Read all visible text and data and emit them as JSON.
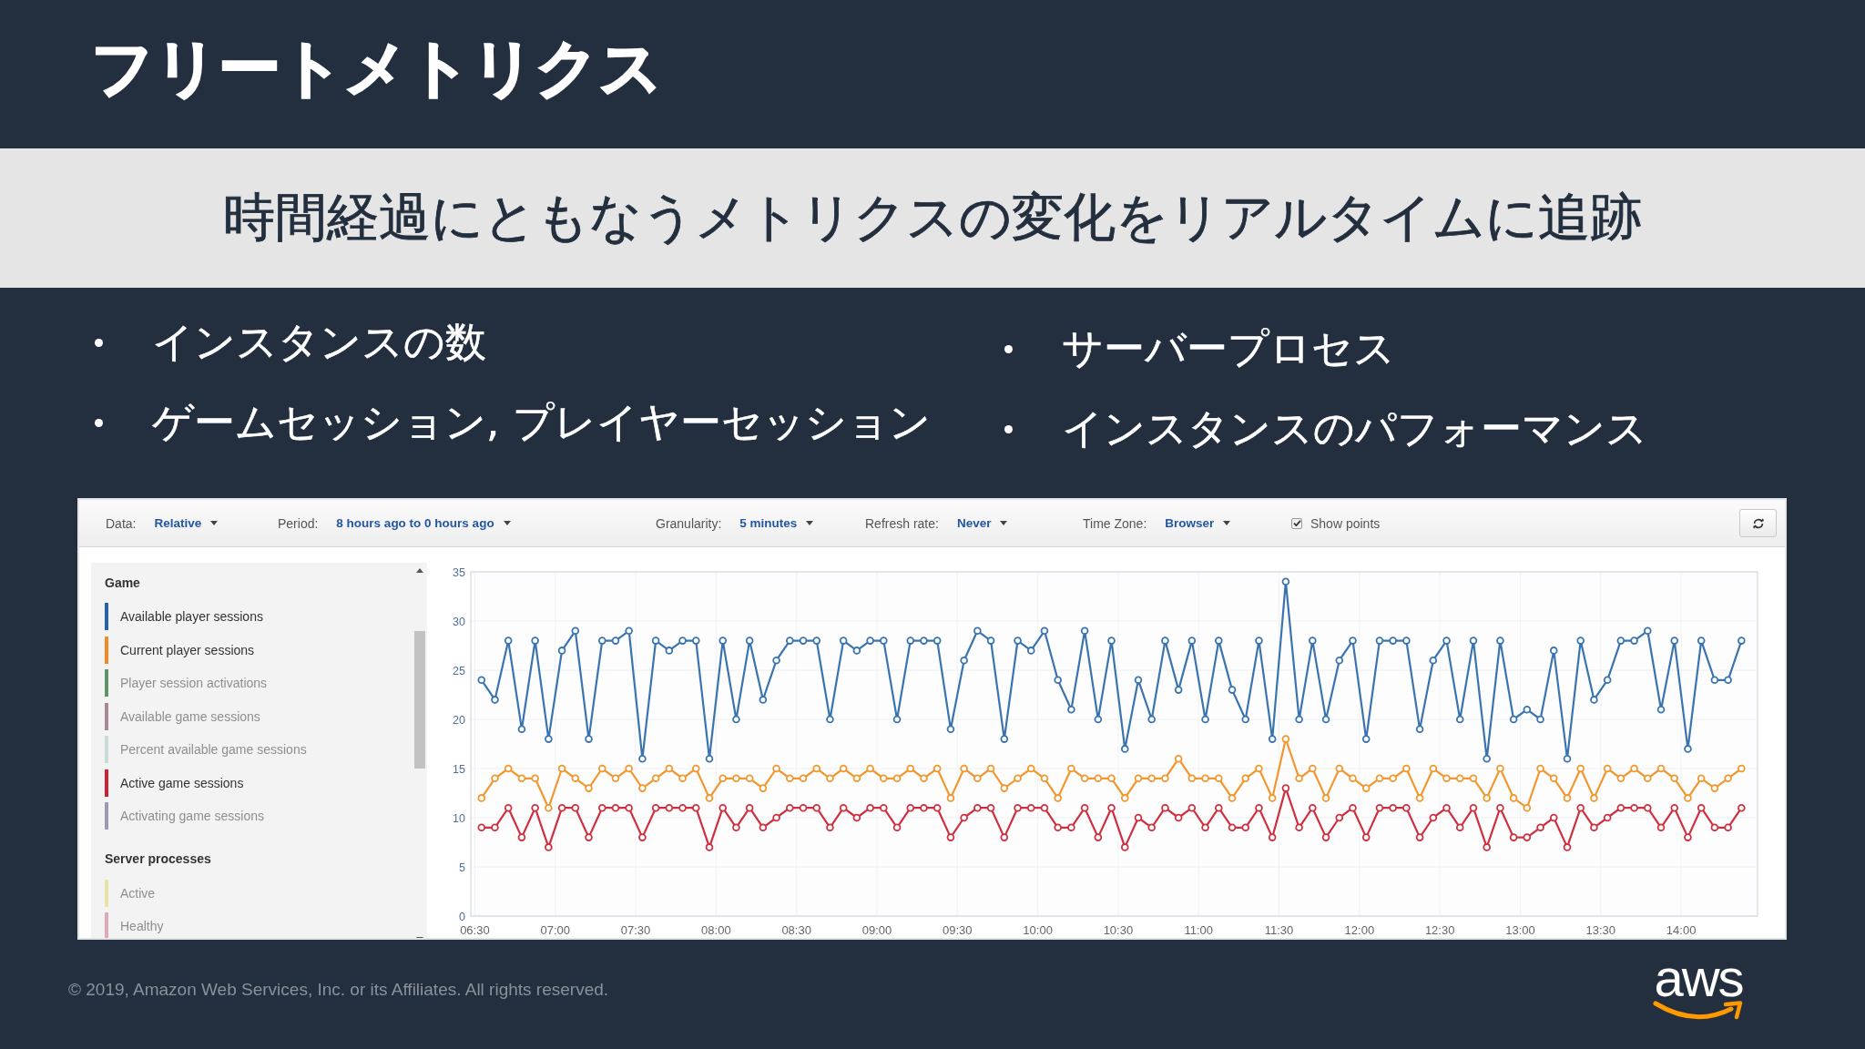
{
  "header": {
    "title": "フリートメトリクス"
  },
  "subtitle": {
    "text": "時間経過にともなうメトリクスの変化をリアルタイムに追跡"
  },
  "bullet_columns": [
    {
      "items": [
        "インスタンスの数",
        "ゲームセッション, プレイヤーセッション"
      ]
    },
    {
      "items": [
        "サーバープロセス",
        "インスタンスのパフォーマンス"
      ]
    }
  ],
  "metrics_console": {
    "toolbar": {
      "filters": [
        {
          "label": "Data:",
          "value": "Relative"
        },
        {
          "label": "Period:",
          "value": "8 hours ago to 0 hours ago"
        },
        {
          "label": "Granularity:",
          "value": "5 minutes"
        },
        {
          "label": "Refresh rate:",
          "value": "Never"
        },
        {
          "label": "Time Zone:",
          "value": "Browser"
        }
      ],
      "show_points": {
        "label": "Show points",
        "checked": true
      }
    },
    "legend": {
      "groups": [
        {
          "title": "Game",
          "items": [
            {
              "label": "Available player sessions",
              "color": "#2563ae",
              "visible": true
            },
            {
              "label": "Current player sessions",
              "color": "#f08a24",
              "visible": true
            },
            {
              "label": "Player session activations",
              "color": "#5e9468",
              "visible": false
            },
            {
              "label": "Available game sessions",
              "color": "#a78896",
              "visible": false
            },
            {
              "label": "Percent available game sessions",
              "color": "#c9dad9",
              "visible": false
            },
            {
              "label": "Active game sessions",
              "color": "#cc2233",
              "visible": true
            },
            {
              "label": "Activating game sessions",
              "color": "#9c9ab3",
              "visible": false
            }
          ]
        },
        {
          "title": "Server processes",
          "items": [
            {
              "label": "Active",
              "color": "#e8e3a8",
              "visible": false
            },
            {
              "label": "Healthy",
              "color": "#dcaab3",
              "visible": false
            }
          ]
        }
      ]
    },
    "chart_data": [
      {
        "type": "line",
        "x": [
          6.5417,
          6.625,
          6.7083,
          6.7917,
          6.875,
          6.9583,
          7.0417,
          7.125,
          7.2083,
          7.2917,
          7.375,
          7.4583,
          7.5417,
          7.625,
          7.7083,
          7.7917,
          7.875,
          7.9583,
          8.0417,
          8.125,
          8.2083,
          8.2917,
          8.375,
          8.4583,
          8.5417,
          8.625,
          8.7083,
          8.7917,
          8.875,
          8.9583,
          9.0417,
          9.125,
          9.2083,
          9.2917,
          9.375,
          9.4583,
          9.5417,
          9.625,
          9.7083,
          9.7917,
          9.875,
          9.9583,
          10.0417,
          10.125,
          10.2083,
          10.2917,
          10.375,
          10.4583,
          10.5417,
          10.625,
          10.7083,
          10.7917,
          10.875,
          10.9583,
          11.0417,
          11.125,
          11.2083,
          11.2917,
          11.375,
          11.4583,
          11.5417,
          11.625,
          11.7083,
          11.7917,
          11.875,
          11.9583,
          12.0417,
          12.125,
          12.2083,
          12.2917,
          12.375,
          12.4583,
          12.5417,
          12.625,
          12.7083,
          12.7917,
          12.875,
          12.9583,
          13.0417,
          13.125,
          13.2083,
          13.2917,
          13.375,
          13.4583,
          13.5417,
          13.625,
          13.7083,
          13.7917,
          13.875,
          13.9583,
          14.0417,
          14.125,
          14.2083,
          14.2917,
          14.375
        ],
        "xlim": [
          6.475,
          14.475
        ],
        "xticks": [
          {
            "value": 6.5,
            "label": "06:30"
          },
          {
            "value": 7,
            "label": "07:00"
          },
          {
            "value": 7.5,
            "label": "07:30"
          },
          {
            "value": 8,
            "label": "08:00"
          },
          {
            "value": 8.5,
            "label": "08:30"
          },
          {
            "value": 9,
            "label": "09:00"
          },
          {
            "value": 9.5,
            "label": "09:30"
          },
          {
            "value": 10,
            "label": "10:00"
          },
          {
            "value": 10.5,
            "label": "10:30"
          },
          {
            "value": 11,
            "label": "11:00"
          },
          {
            "value": 11.5,
            "label": "11:30"
          },
          {
            "value": 12,
            "label": "12:00"
          },
          {
            "value": 12.5,
            "label": "12:30"
          },
          {
            "value": 13,
            "label": "13:00"
          },
          {
            "value": 13.5,
            "label": "13:30"
          },
          {
            "value": 14,
            "label": "14:00"
          }
        ],
        "ylim": [
          0,
          35
        ],
        "yticks": [
          0,
          5,
          10,
          15,
          20,
          25,
          30,
          35
        ],
        "grid": true,
        "marker": "circle",
        "series": [
          {
            "color": "#3a74b0",
            "values": [
              24,
              22,
              28,
              19,
              28,
              18,
              27,
              29,
              18,
              28,
              28,
              29,
              16,
              28,
              27,
              28,
              28,
              16,
              28,
              20,
              28,
              22,
              26,
              28,
              28,
              28,
              20,
              28,
              27,
              28,
              28,
              20,
              28,
              28,
              28,
              19,
              26,
              29,
              28,
              18,
              28,
              27,
              29,
              24,
              21,
              29,
              20,
              28,
              17,
              24,
              20,
              28,
              23,
              28,
              20,
              28,
              23,
              20,
              28,
              18,
              34,
              20,
              28,
              20,
              26,
              28,
              18,
              28,
              28,
              28,
              19,
              26,
              28,
              20,
              28,
              16,
              28,
              20,
              21,
              20,
              27,
              16,
              28,
              22,
              24,
              28,
              28,
              29,
              21,
              28,
              17,
              28,
              24,
              24,
              28
            ]
          },
          {
            "color": "#f2972e",
            "values": [
              12,
              14,
              15,
              14,
              14,
              11,
              15,
              14,
              13,
              15,
              14,
              15,
              13,
              14,
              15,
              14,
              15,
              12,
              14,
              14,
              14,
              13,
              15,
              14,
              14,
              15,
              14,
              15,
              14,
              15,
              14,
              14,
              15,
              14,
              15,
              12,
              15,
              14,
              15,
              13,
              14,
              15,
              14,
              12,
              15,
              14,
              14,
              14,
              12,
              14,
              14,
              14,
              16,
              14,
              14,
              14,
              12,
              14,
              15,
              12,
              18,
              14,
              15,
              12,
              15,
              14,
              13,
              14,
              14,
              15,
              12,
              15,
              14,
              14,
              14,
              12,
              15,
              12,
              11,
              15,
              14,
              12,
              15,
              12,
              15,
              14,
              15,
              14,
              15,
              14,
              12,
              14,
              13,
              14,
              15
            ]
          },
          {
            "color": "#cf303f",
            "values": [
              9,
              9,
              11,
              8,
              11,
              7,
              11,
              11,
              8,
              11,
              11,
              11,
              8,
              11,
              11,
              11,
              11,
              7,
              11,
              9,
              11,
              9,
              10,
              11,
              11,
              11,
              9,
              11,
              10,
              11,
              11,
              9,
              11,
              11,
              11,
              8,
              10,
              11,
              11,
              8,
              11,
              11,
              11,
              9,
              9,
              11,
              8,
              11,
              7,
              10,
              9,
              11,
              10,
              11,
              9,
              11,
              9,
              9,
              11,
              8,
              13,
              9,
              11,
              8,
              10,
              11,
              8,
              11,
              11,
              11,
              8,
              10,
              11,
              9,
              11,
              7,
              11,
              8,
              8,
              9,
              10,
              7,
              11,
              9,
              10,
              11,
              11,
              11,
              9,
              11,
              8,
              11,
              9,
              9,
              11
            ]
          }
        ]
      }
    ]
  },
  "footer": {
    "copyright": "© 2019, Amazon Web Services, Inc. or its Affiliates. All rights reserved.",
    "logo": "aws"
  }
}
